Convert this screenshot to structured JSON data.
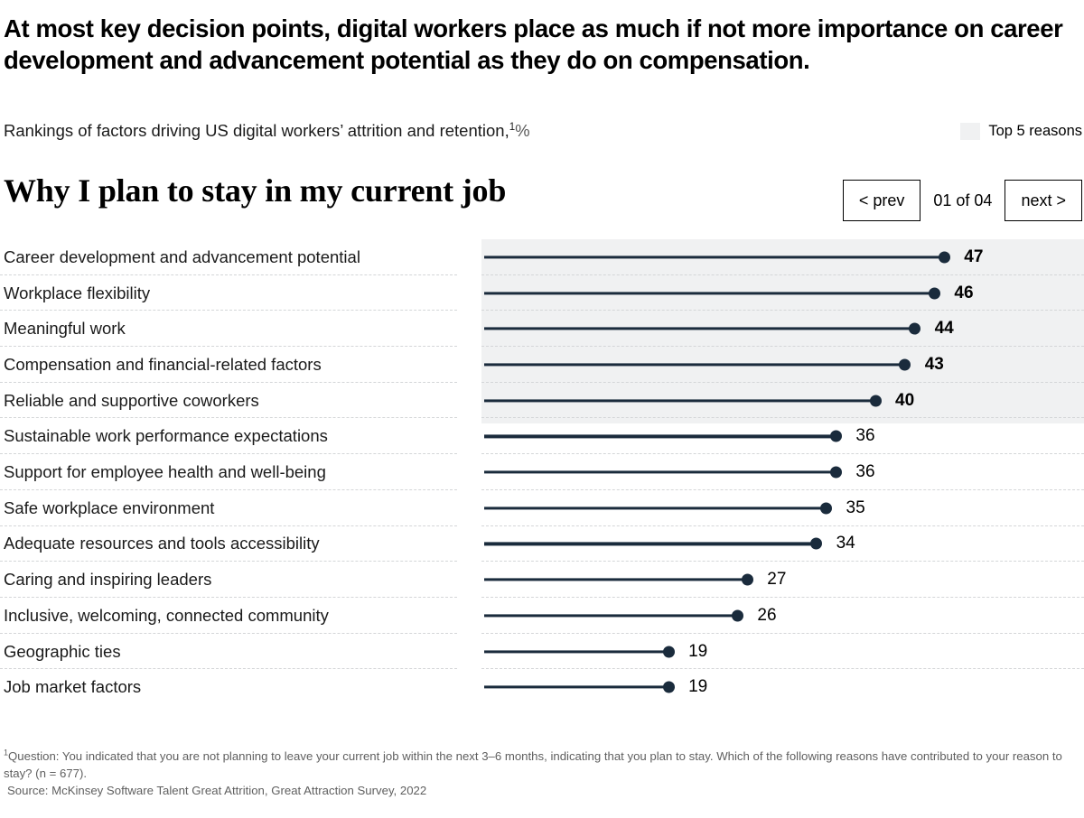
{
  "headline": "At most key decision points, digital workers place as much if not more importance on career development and advancement potential as they do on compensation.",
  "subtitle": {
    "text": "Rankings of factors driving US digital workers’ attrition and retention,",
    "footnote_marker": "1",
    "unit": "%"
  },
  "legend": {
    "label": "Top 5 reasons",
    "swatch_color": "#f0f1f2"
  },
  "chart_title": "Why I plan to stay in my current job",
  "nav": {
    "prev_label": "< prev",
    "counter": "01 of 04",
    "next_label": "next >"
  },
  "footnotes": {
    "question": "Question: You indicated that you are not planning to leave your current job within the next 3–6 months, indicating that you plan to stay. Which of the following reasons have contributed to your reason to stay? (n = 677).",
    "question_marker": "1",
    "source": "Source: McKinsey Software Talent Great Attrition, Great Attraction Survey, 2022"
  },
  "colors": {
    "lollipop": "#1a2b3c",
    "band": "#f0f1f2",
    "rule": "#d4d6d8"
  },
  "chart_data": {
    "type": "bar",
    "title": "Why I plan to stay in my current job",
    "subtitle": "Rankings of factors driving US digital workers’ attrition and retention, %",
    "xlabel": "",
    "ylabel": "",
    "xlim": [
      0,
      50
    ],
    "grid": false,
    "orientation": "horizontal",
    "highlight": "Top 5 reasons",
    "highlight_count": 5,
    "categories": [
      "Career development and advancement potential",
      "Workplace flexibility",
      "Meaningful work",
      "Compensation and financial-related factors",
      "Reliable and supportive coworkers",
      "Sustainable work performance expectations",
      "Support for employee health and well-being",
      "Safe workplace environment",
      "Adequate resources and tools accessibility",
      "Caring and inspiring leaders",
      "Inclusive, welcoming, connected community",
      "Geographic ties",
      "Job market factors"
    ],
    "values": [
      47,
      46,
      44,
      43,
      40,
      36,
      36,
      35,
      34,
      27,
      26,
      19,
      19
    ]
  }
}
